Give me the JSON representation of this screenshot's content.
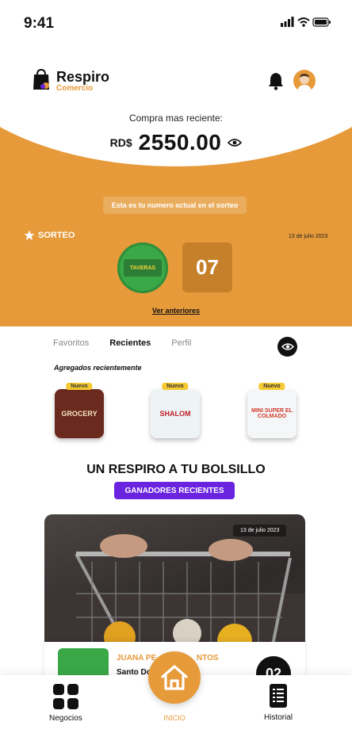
{
  "status_bar": {
    "time": "9:41"
  },
  "brand": {
    "name": "Respiro",
    "subtitle": "Comercio"
  },
  "purchase": {
    "label": "Compra mas reciente:",
    "currency": "RD$",
    "amount": "2550.00"
  },
  "sorteo": {
    "pill_text": "Esta es tu numero actual en el sorteo",
    "title": "SORTEO",
    "date": "13 de julio 2023",
    "badge_text": "TAVERAS",
    "number": "07",
    "link": "Ver anteriores"
  },
  "tabs": [
    {
      "label": "Favoritos",
      "active": false
    },
    {
      "label": "Recientes",
      "active": true
    },
    {
      "label": "Perfil",
      "active": false
    }
  ],
  "recent": {
    "title": "Agregados recientemente",
    "items": [
      {
        "badge": "Nuevo",
        "label": "GROCERY"
      },
      {
        "badge": "Nuevo",
        "label": "SHALOM"
      },
      {
        "badge": "Nuevo",
        "label": "MINI SUPER EL COLMADO"
      }
    ]
  },
  "slogan": "UN RESPIRO A TU BOLSILLO",
  "winners_button": "GANADORES RECIENTES",
  "winner": {
    "date": "13 de julio 2023",
    "name": "JUANA PE",
    "name_tail": "NTOS",
    "location": "Santo Do",
    "number": "02"
  },
  "bottom_nav": {
    "negocios": "Negocios",
    "inicio": "INICIO",
    "historial": "Historial"
  },
  "colors": {
    "accent": "#e69a3a",
    "winners_button": "#6a24e0"
  }
}
